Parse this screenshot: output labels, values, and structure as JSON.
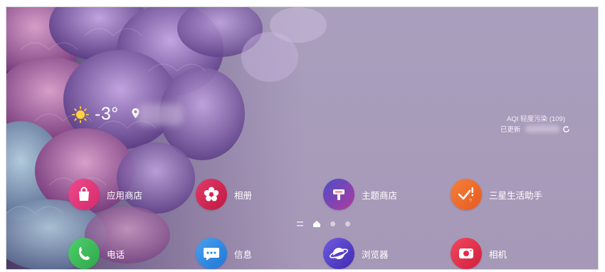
{
  "weather": {
    "temperature": "-3°",
    "icon": "sun-icon",
    "aqi": "AQI 轻度污染 (109)",
    "updated": "已更新"
  },
  "page_indicator": {
    "pages": 4,
    "current": 1
  },
  "apps": [
    {
      "label": "应用商店",
      "icon": "shopping-bag-icon",
      "color": "#e4337b"
    },
    {
      "label": "相册",
      "icon": "flower-icon",
      "color": "#d42356"
    },
    {
      "label": "主题商店",
      "icon": "paint-brush-icon",
      "color": "#7a3fb0"
    },
    {
      "label": "三星生活助手",
      "icon": "checkmark-alert-icon",
      "color": "#f06a2a"
    }
  ],
  "dock": [
    {
      "label": "电话",
      "icon": "phone-icon",
      "color": "#3cb95c"
    },
    {
      "label": "信息",
      "icon": "chat-icon",
      "color": "#2f8ae0"
    },
    {
      "label": "浏览器",
      "icon": "planet-icon",
      "color": "#5a3ec9"
    },
    {
      "label": "相机",
      "icon": "camera-icon",
      "color": "#e8264c"
    }
  ]
}
